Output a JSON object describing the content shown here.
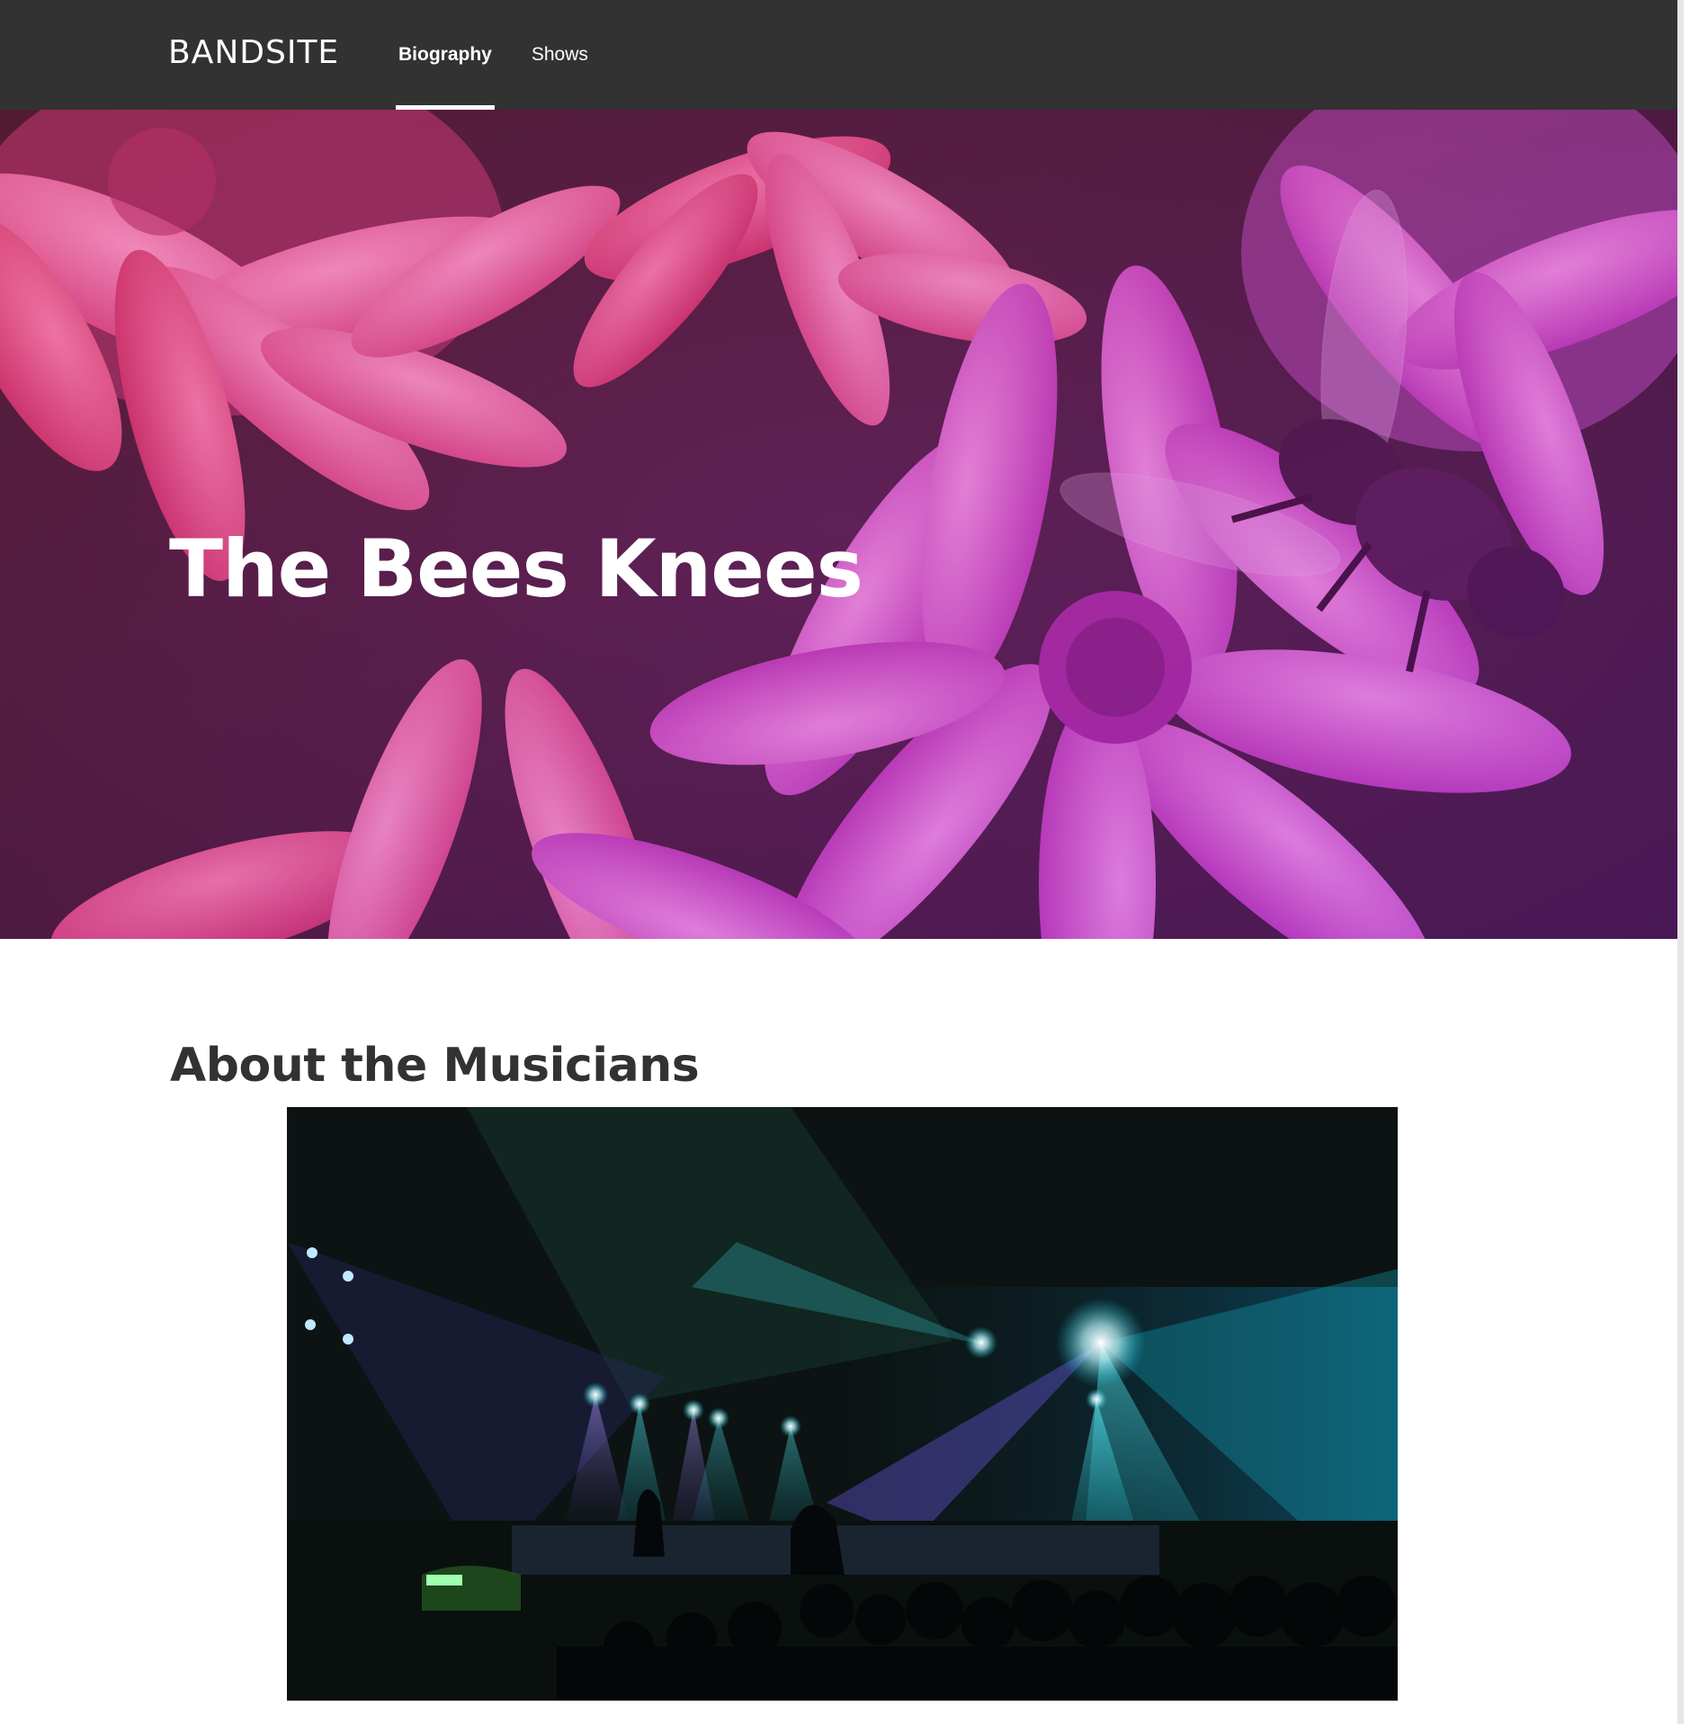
{
  "header": {
    "logo": "BANDSITE",
    "nav": [
      {
        "label": "Biography",
        "active": true
      },
      {
        "label": "Shows",
        "active": false
      }
    ],
    "background_color": "#323232"
  },
  "hero": {
    "title": "The Bees Knees",
    "image": "flowers-with-bee-photo"
  },
  "about": {
    "heading": "About the Musicians",
    "image": "concert-stage-photo"
  },
  "colors": {
    "text_dark": "#323232",
    "accent_magenta": "#c040c0"
  }
}
